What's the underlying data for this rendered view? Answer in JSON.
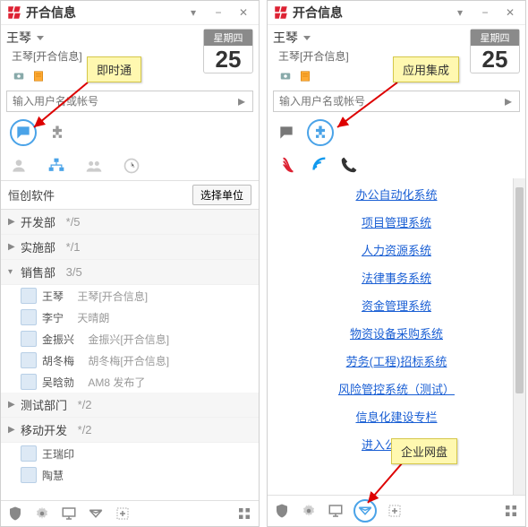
{
  "app_title": "开合信息",
  "user_name": "王琴",
  "status_line": "王琴[开合信息]",
  "search_placeholder": "输入用户名或帐号",
  "date": {
    "weekday": "星期四",
    "day": "25"
  },
  "left": {
    "callout": "即时通",
    "org_name": "恒创软件",
    "select_unit": "选择单位",
    "departments": [
      {
        "name": "开发部",
        "count": "*/5",
        "expanded": false
      },
      {
        "name": "实施部",
        "count": "*/1",
        "expanded": false
      },
      {
        "name": "销售部",
        "count": "3/5",
        "expanded": true,
        "members": [
          {
            "name": "王琴",
            "note": "王琴[开合信息]"
          },
          {
            "name": "李宁",
            "note": "天晴朗"
          },
          {
            "name": "金振兴",
            "note": "金振兴[开合信息]"
          },
          {
            "name": "胡冬梅",
            "note": "胡冬梅[开合信息]"
          },
          {
            "name": "吴晗勍",
            "note": "AM8 发布了"
          }
        ]
      },
      {
        "name": "测试部门",
        "count": "*/2",
        "expanded": false
      },
      {
        "name": "移动开发",
        "count": "*/2",
        "expanded": false
      }
    ],
    "loose_members": [
      {
        "name": "王瑞印"
      },
      {
        "name": "陶慧"
      }
    ]
  },
  "right": {
    "callout_top": "应用集成",
    "callout_bottom": "企业网盘",
    "links": [
      "办公自动化系统",
      "项目管理系统",
      "人力资源系统",
      "法律事务系统",
      "资金管理系统",
      "物资设备采购系统",
      "劳务(工程)招标系统",
      "风险管控系统（测试）",
      "信息化建设专栏",
      "进入公司网站"
    ]
  }
}
